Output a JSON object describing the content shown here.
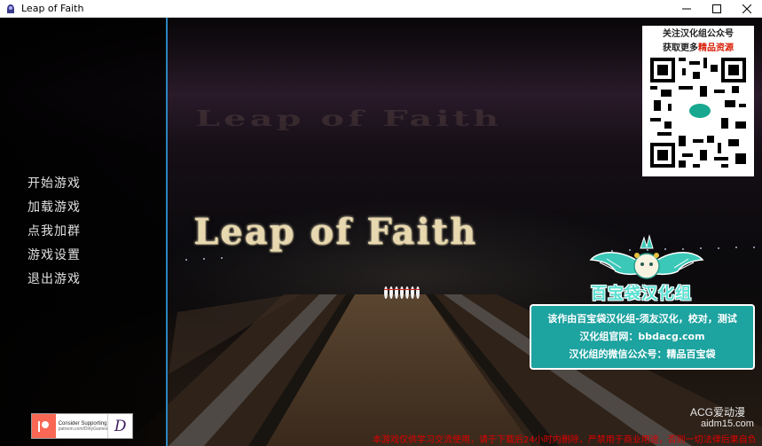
{
  "window": {
    "title": "Leap of Faith",
    "controls": [
      "minimize-icon",
      "maximize-icon",
      "close-icon"
    ]
  },
  "game": {
    "title_logo": "Leap of Faith",
    "ghost_title": "Leap of Faith"
  },
  "menu": {
    "items": [
      {
        "label": "开始游戏"
      },
      {
        "label": "加载游戏"
      },
      {
        "label": "点我加群"
      },
      {
        "label": "游戏设置"
      },
      {
        "label": "退出游戏"
      }
    ]
  },
  "support_badge": {
    "line1": "Consider Supporting",
    "line2": "patreon.com/DirtyGames",
    "logo": "D"
  },
  "qr_card": {
    "line1": "关注汉化组公众号",
    "line2_prefix": "获取更多",
    "line2_highlight": "精品资源"
  },
  "group": {
    "name": "百宝袋汉化组"
  },
  "info_box": {
    "line1": "该作由百宝袋汉化组-须友汉化，校对，测试",
    "line2": "汉化组官网：bbdacg.com",
    "line3": "汉化组的微信公众号：精品百宝袋"
  },
  "watermark": {
    "brand": "ACG爱动漫",
    "url": "aidm15.com"
  },
  "disclaimer": "本游戏仅供学习交流使用，请于下载后24小时内删除，严禁用于商业用途，否则一切法律后果自负",
  "colors": {
    "panel_edge": "#2c86c0",
    "info_box_bg": "#1da3a0",
    "group_name": "#5be0d2",
    "highlight_red": "#d81e06",
    "patreon": "#f96854"
  }
}
